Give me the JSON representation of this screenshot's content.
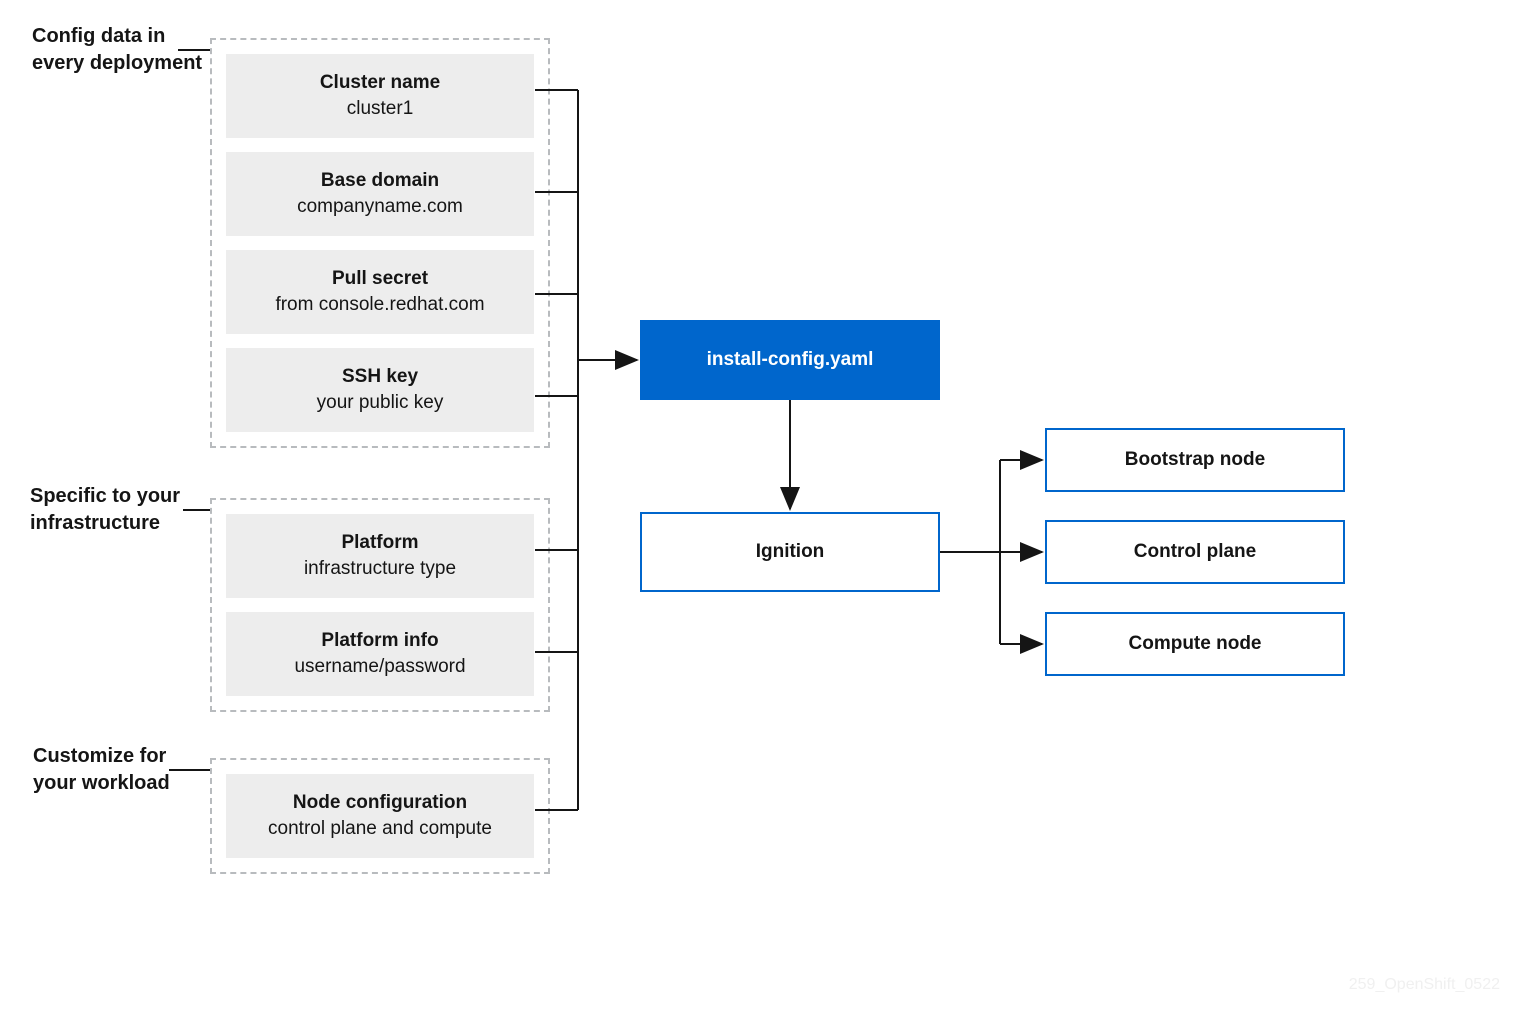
{
  "labels": {
    "group1": "Config data in\nevery deployment",
    "group2": "Specific to your\ninfrastructure",
    "group3": "Customize for\nyour workload"
  },
  "group1": {
    "items": [
      {
        "title": "Cluster name",
        "subtitle": "cluster1"
      },
      {
        "title": "Base domain",
        "subtitle": "companyname.com"
      },
      {
        "title": "Pull secret",
        "subtitle": "from console.redhat.com"
      },
      {
        "title": "SSH key",
        "subtitle": "your public key"
      }
    ]
  },
  "group2": {
    "items": [
      {
        "title": "Platform",
        "subtitle": "infrastructure type"
      },
      {
        "title": "Platform info",
        "subtitle": "username/password"
      }
    ]
  },
  "group3": {
    "items": [
      {
        "title": "Node configuration",
        "subtitle": "control plane and compute"
      }
    ]
  },
  "center": {
    "install_config": "install-config.yaml",
    "ignition": "Ignition"
  },
  "outputs": [
    "Bootstrap node",
    "Control plane",
    "Compute node"
  ],
  "watermark": "259_OpenShift_0522"
}
